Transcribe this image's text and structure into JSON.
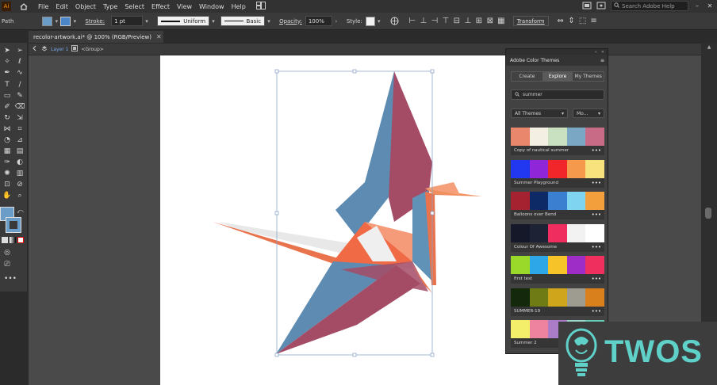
{
  "menubar": {
    "app_logo": "Ai",
    "items": [
      "File",
      "Edit",
      "Object",
      "Type",
      "Select",
      "Effect",
      "View",
      "Window",
      "Help"
    ],
    "search_placeholder": "Search Adobe Help"
  },
  "controlbar": {
    "label": "Path",
    "stroke_label": "Stroke:",
    "stroke_weight": "1 pt",
    "profile": "Uniform",
    "brush": "Basic",
    "opacity_label": "Opacity:",
    "opacity_value": "100%",
    "style_label": "Style:",
    "transform_label": "Transform",
    "fill_color": "#6a9ec8",
    "stroke_color": "#6a9ec8"
  },
  "document": {
    "tab_title": "recolor-artwork.ai* @ 100% (RGB/Preview)",
    "breadcrumb_layer": "Layer 1",
    "breadcrumb_group": "<Group>"
  },
  "panel": {
    "title": "Adobe Color Themes",
    "tabs": [
      "Create",
      "Explore",
      "My Themes"
    ],
    "active_tab": "Explore",
    "search_value": "summer",
    "filter_all": "All Themes",
    "filter_sort": "Mo...",
    "themes": [
      {
        "name": "Copy of nautical summer",
        "colors": [
          "#e8876b",
          "#f3efe2",
          "#c9e0c1",
          "#79a7c4",
          "#c76b86"
        ]
      },
      {
        "name": "Summer Playground",
        "colors": [
          "#2238f0",
          "#8f27d8",
          "#f0262b",
          "#f59a4c",
          "#f8e27e"
        ]
      },
      {
        "name": "Balloons over Bend",
        "colors": [
          "#a52231",
          "#0d2a66",
          "#3a7fd0",
          "#7fd5ef",
          "#f3a03c"
        ]
      },
      {
        "name": "Colour Of Awesome",
        "colors": [
          "#141828",
          "#1d2234",
          "#ef2d5f",
          "#f2f2f2",
          "#ffffff"
        ]
      },
      {
        "name": "first test",
        "colors": [
          "#9ad82a",
          "#2da7e8",
          "#f6c429",
          "#9e2cc7",
          "#ef2f5d"
        ]
      },
      {
        "name": "SUMMER-19",
        "colors": [
          "#14290b",
          "#6f7c15",
          "#cfa51c",
          "#9e9c91",
          "#d97f1b"
        ]
      },
      {
        "name": "Summer 2",
        "colors": [
          "#f4ef6a",
          "#ee83a0",
          "#ab7cc7",
          "#9bd7c8",
          "#66cbb5"
        ]
      }
    ]
  },
  "watermark": {
    "text": "TWOS"
  }
}
